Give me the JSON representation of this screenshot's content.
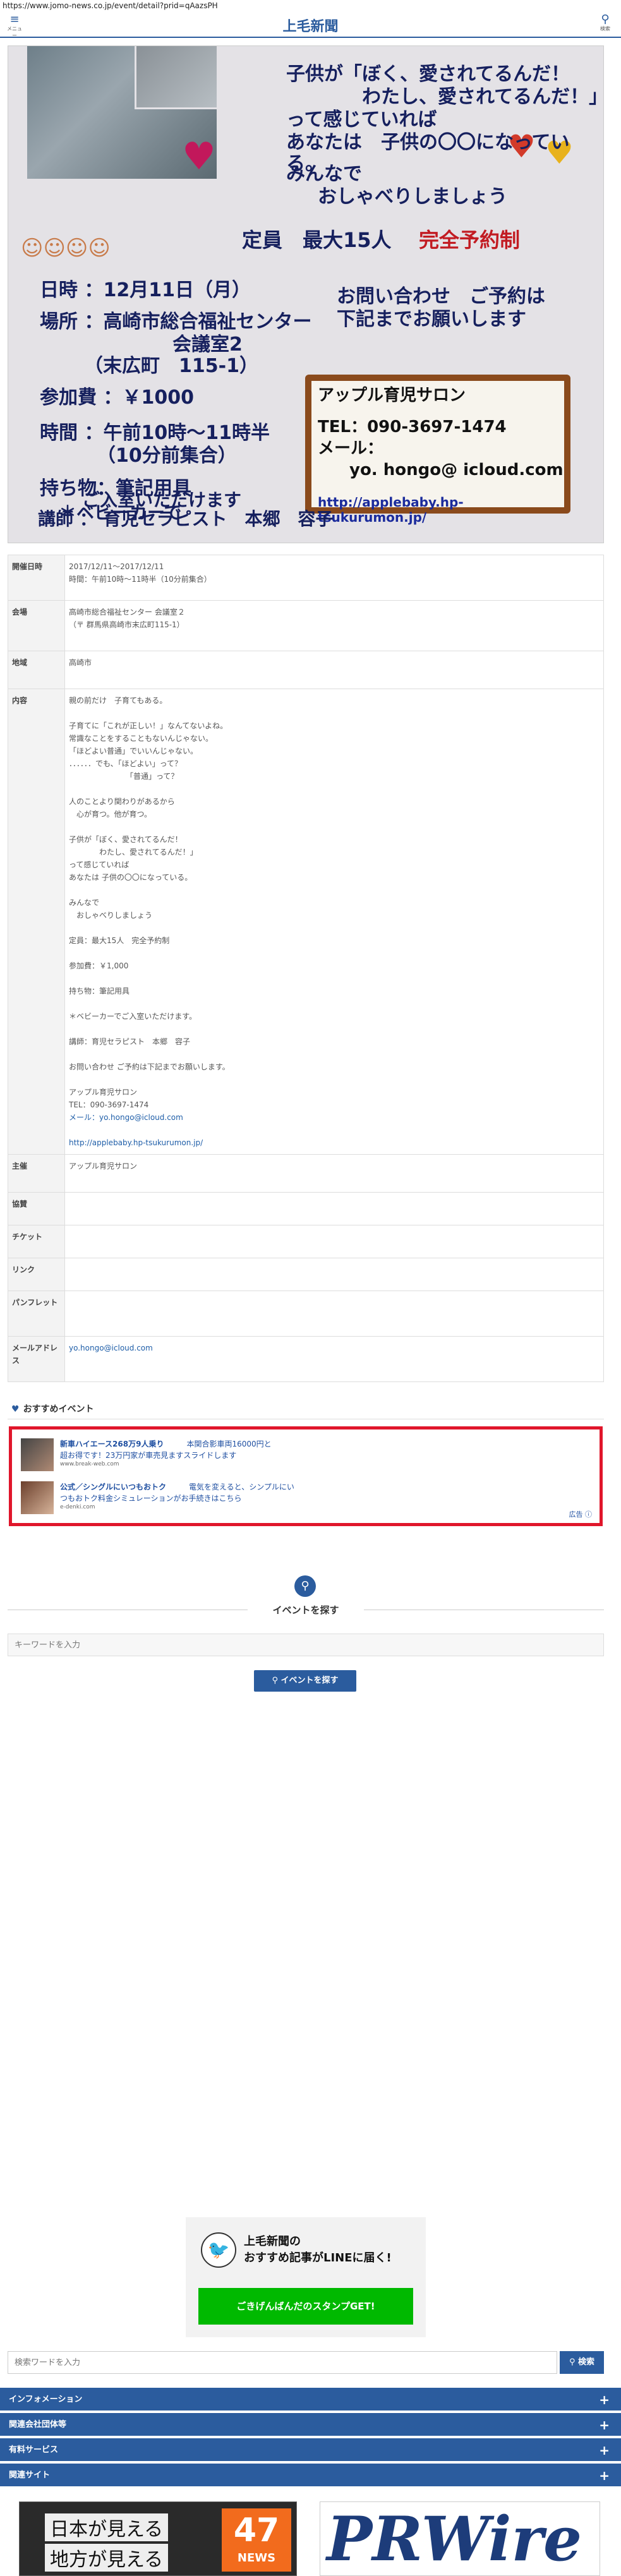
{
  "browser": {
    "url": "https://www.jomo-news.co.jp/event/detail?prid=qAazsPH"
  },
  "header": {
    "menu_icon": "≡",
    "menu_label": "メニュー",
    "site_title": "上毛新聞",
    "search_icon": "⚲",
    "search_label": "検索"
  },
  "poster": {
    "headline_1": "子供が「ぼく、愛されてるんだ！",
    "headline_2": "わたし、愛されてるんだ！」",
    "headline_3": "って感じていれば",
    "headline_4": "あなたは　子供の〇〇になっている。",
    "sub_1": "みんなで",
    "sub_2": "おしゃべりしましょう",
    "capacity": "定員　最大15人",
    "reservation": "完全予約制",
    "date": "日時 ：12月11日（月）",
    "place_1": "場所 ：高崎市総合福祉センター",
    "place_2": "会議室2",
    "place_3": "（末広町　115-1）",
    "fee": "参加費 ：￥1000",
    "time_1": "時間 ：午前10時～11時半",
    "time_2": "（10分前集合）",
    "bring": "持ち物：筆記用具",
    "stroller_1": "＊ベビーカーで",
    "stroller_2": "ご入室いただけます",
    "lecturer": "講師 ： 育児セラピスト　本郷　容子",
    "contact_1": "お問い合わせ　ご予約は",
    "contact_2": "下記までお願いします",
    "salon": "アップル育児サロン",
    "tel": "TEL：090-3697-1474",
    "mail_label": "メール：",
    "mail": "yo. hongo@ icloud.com",
    "url": "http://applebaby.hp-tsukurumon.jp/"
  },
  "details": {
    "rows": [
      {
        "key": "開催日時",
        "lines": [
          "2017/12/11～2017/12/11",
          "時間：午前10時～11時半（10分前集合）"
        ]
      },
      {
        "key": "会場",
        "lines": [
          "高崎市総合福祉センター 会議室２",
          "（〒 群馬県高崎市末広町115-1）"
        ]
      },
      {
        "key": "地域",
        "lines": [
          "高崎市"
        ]
      }
    ],
    "content_key": "内容",
    "content_lines": [
      "親の前だけ　子育てもある。",
      "",
      "子育てに「これが正しい！」なんてないよね。",
      "常識なことをすることもないんじゃない。",
      "「ほどよい普通」でいいんじゃない。",
      "．．．．．．でも、「ほどよい」って？",
      "　　　　　　　　「普通」って？",
      "",
      "人のことより関わりがあるから",
      "　心が育つ。他が育つ。",
      "",
      "子供が「ぼく、愛されてるんだ！",
      "　　　　わたし、愛されてるんだ！」",
      "って感じていれば",
      "あなたは 子供の〇〇になっている。",
      "",
      "みんなで",
      "　おしゃべりしましょう",
      "",
      "定員：最大15人　完全予約制",
      "",
      "参加費：￥1,000",
      "",
      "持ち物：筆記用具",
      "",
      "＊ベビーカーでご入室いただけます。",
      "",
      "講師：育児セラピスト　本郷　容子",
      "",
      "お問い合わせ ご予約は下記までお願いします。",
      "",
      "アップル育児サロン",
      "TEL：090-3697-1474",
      "メール：yo.hongo@icloud.com",
      "",
      "http://applebaby.hp-tsukurumon.jp/"
    ],
    "organizer_key": "主催",
    "organizer": "アップル育児サロン",
    "support_key": "協賛",
    "support": "",
    "ticket_key": "チケット",
    "ticket": "",
    "link_key": "リンク",
    "link": "",
    "pamphlet_key": "パンフレット",
    "pamphlet": "",
    "email_key": "メールアドレス",
    "email": "yo.hongo@icloud.com"
  },
  "recommended": {
    "heart_icon": "♥",
    "title": "おすすめイベント",
    "ads": [
      {
        "title": "新車ハイエース268万9人乗り",
        "title2": "本関合影車両16000円と",
        "desc": "超お得です！23万円家が車売見ますスライドします",
        "domain": "www.break-web.com"
      },
      {
        "title": "公式／シングルにいつもおトク",
        "title2": "電気を変えると、シンプルにい",
        "desc": "つもおトク料金シミュレーションがお手続きはこちら",
        "domain": "e-denki.com"
      }
    ],
    "ad_mark": "広告 ⓘ"
  },
  "find_events": {
    "icon": "⚲",
    "title": "イベントを探す",
    "placeholder": "キーワードを入力",
    "button": "⚲  イベントを探す"
  },
  "line_banner": {
    "bird": "🐦",
    "line1": "上毛新聞の",
    "line2": "おすすめ記事がLINEに届く!",
    "button": "ごきげんばんだのスタンプGET!"
  },
  "footer_search": {
    "placeholder": "検索ワードを入力",
    "button": "⚲ 検索"
  },
  "accordion": [
    {
      "label": "インフォメーション",
      "plus": "+"
    },
    {
      "label": "関連会社団体等",
      "plus": "+"
    },
    {
      "label": "有料サービス",
      "plus": "+"
    },
    {
      "label": "関連サイト",
      "plus": "+"
    }
  ],
  "banners": {
    "b47_line1": "日本が見える",
    "b47_line2": "地方が見える",
    "b47_num": "47",
    "b47_news": "NEWS",
    "pr": "PRWire"
  }
}
